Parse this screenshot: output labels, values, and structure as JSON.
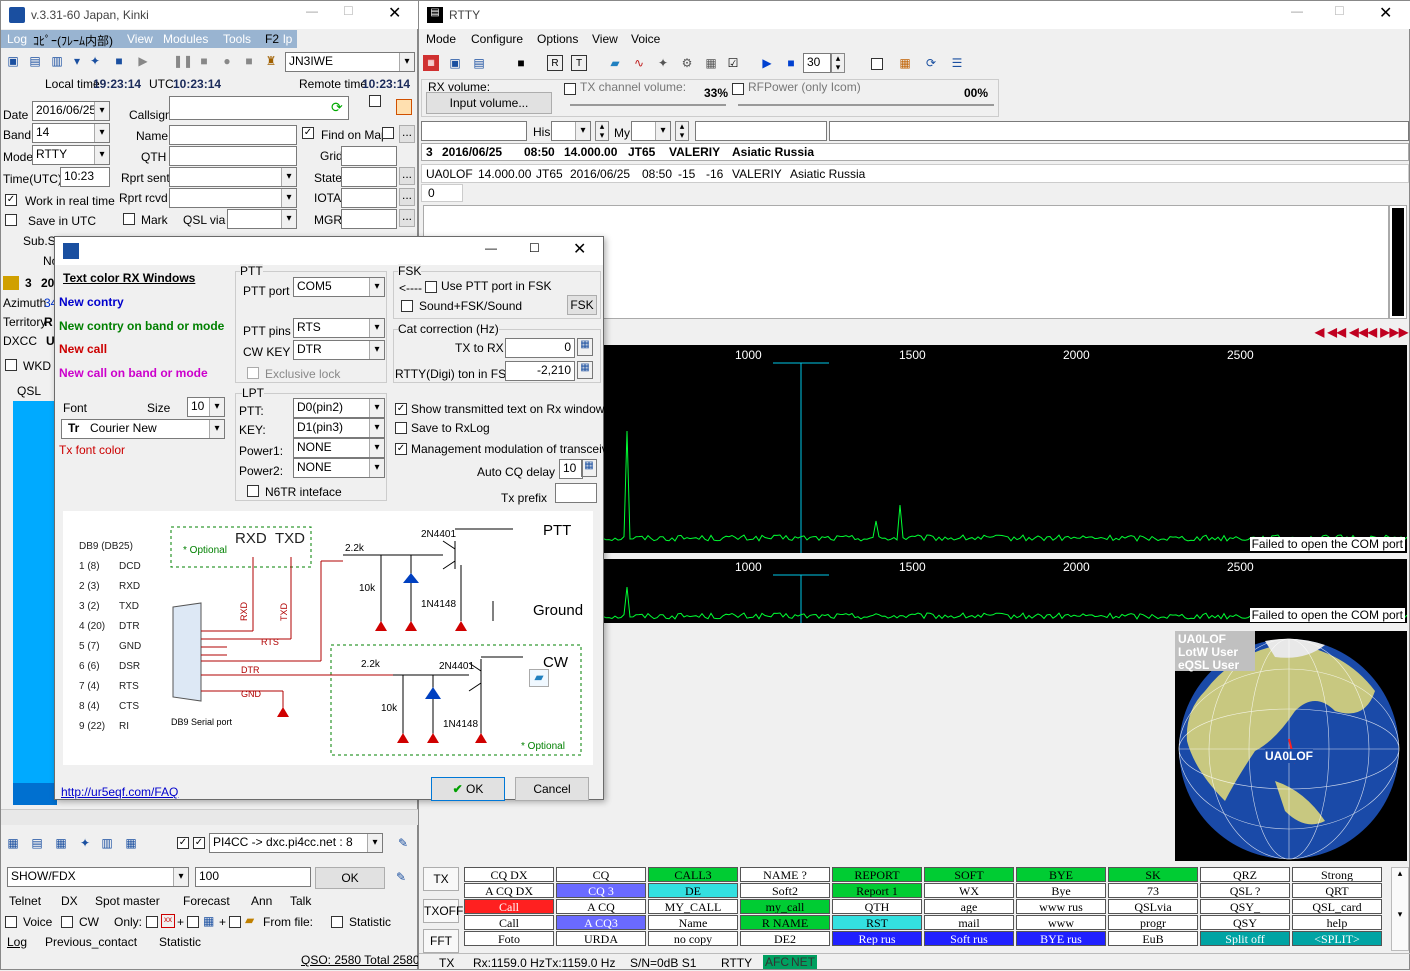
{
  "left": {
    "title": "v.3.31-60 Japan, Kinki",
    "menu": [
      "Log",
      "ｺﾋﾟｰ(ﾌﾚｰﾑ内部)",
      "View",
      "Modules",
      "Tools",
      "F2",
      "lp"
    ],
    "callsign_combo": "JN3IWE",
    "local_time_label": "Local time",
    "local_time": "19:23:14",
    "utc_label": "UTC",
    "utc_time": "10:23:14",
    "remote_label": "Remote time",
    "remote_time": "10:23:14",
    "fields": {
      "date_label": "Date",
      "date": "2016/06/25",
      "band_label": "Band",
      "band": "14",
      "mode_label": "Mode",
      "mode": "RTTY",
      "time_label": "Time(UTC)",
      "time": "10:23",
      "callsign_label": "Callsign",
      "name_label": "Name",
      "qth_label": "QTH",
      "rprt_sent_label": "Rprt sent",
      "rprt_rcvd_label": "Rprt rcvd",
      "qsl_via_label": "QSL via",
      "find_map_label": "Find on Map",
      "grid_label": "Grid",
      "state_label": "State",
      "iota_label": "IOTA",
      "mgr_label": "MGR",
      "work_real_label": "Work in real time",
      "save_utc_label": "Save in UTC",
      "mark_label": "Mark",
      "substate_label": "Sub.St",
      "no_label": "No"
    },
    "info": {
      "count": "3",
      "count2": "20",
      "azimuth_label": "Azimuth",
      "azimuth": "34",
      "territory_label": "Territory",
      "territory": "R",
      "dxcc_label": "DXCC",
      "dxcc": "U",
      "wkd_label": "WKD",
      "qsl_label": "QSL"
    },
    "cluster": {
      "server": "PI4CC -> dxc.pi4cc.net : 8",
      "show_cmd": "SHOW/FDX",
      "count": "100",
      "ok": "OK"
    },
    "tabs1": [
      "Telnet",
      "DX",
      "Spot master",
      "Forecast",
      "Ann",
      "Talk"
    ],
    "filter": {
      "voice": "Voice",
      "cw": "CW",
      "only": "Only:",
      "from_file": "From file:",
      "statistic": "Statistic"
    },
    "tabs2": [
      "Log",
      "Previous_contact",
      "Statistic"
    ],
    "status": "QSO: 2580 Total 2580"
  },
  "dialog": {
    "text_color_title": "Text color RX Windows",
    "colors": [
      {
        "t": "New contry",
        "c": "#0000cc"
      },
      {
        "t": "New contry on band or mode",
        "c": "#008000"
      },
      {
        "t": "New call",
        "c": "#cc0000"
      },
      {
        "t": "New call on band or mode",
        "c": "#cc00cc"
      }
    ],
    "font_label": "Font",
    "size_label": "Size",
    "size": "10",
    "font": "Courier New",
    "tx_font": "Tx font color",
    "ptt_group": "PTT",
    "ptt_port_label": "PTT port",
    "ptt_port": "COM5",
    "ptt_pins_label": "PTT pins",
    "ptt_pins": "RTS",
    "cw_key_label": "CW KEY",
    "cw_key": "DTR",
    "exclusive": "Exclusive lock",
    "lpt_group": "LPT",
    "lpt_ptt_label": "PTT:",
    "lpt_ptt": "D0(pin2)",
    "lpt_key_label": "KEY:",
    "lpt_key": "D1(pin3)",
    "power1_label": "Power1:",
    "power1": "NONE",
    "power2_label": "Power2:",
    "power2": "NONE",
    "n6tr": "N6TR inteface",
    "fsk_group": "FSK",
    "use_ptt_fsk": "Use PTT port in FSK",
    "sound_fsk": "Sound+FSK/Sound",
    "fsk_btn": "FSK",
    "arrow": "<----",
    "cat_group": "Cat correction (Hz)",
    "tx_to_rx_label": "TX to RX",
    "tx_to_rx": "0",
    "rtty_fsk_label": "RTTY(Digi) ton in FSK",
    "rtty_fsk": "-2,210",
    "show_tx": "Show transmitted text on Rx window",
    "save_rxlog": "Save to RxLog",
    "mgmt_mod": "Management modulation  of transceiver",
    "autocq_label": "Auto CQ delay",
    "autocq": "10",
    "txprefix_label": "Tx prefix",
    "link": "http://ur5eqf.com/FAQ",
    "ok": "OK",
    "cancel": "Cancel",
    "diagram": {
      "db9": "DB9 (DB25)",
      "pins": [
        [
          "1 (8)",
          "DCD"
        ],
        [
          "2 (3)",
          "RXD"
        ],
        [
          "3 (2)",
          "TXD"
        ],
        [
          "4 (20)",
          "DTR"
        ],
        [
          "5 (7)",
          "GND"
        ],
        [
          "6 (6)",
          "DSR"
        ],
        [
          "7 (4)",
          "RTS"
        ],
        [
          "8 (4)",
          "CTS"
        ],
        [
          "9 (22)",
          "RI"
        ]
      ],
      "optional": "* Optional",
      "rxd": "RXD",
      "txd": "TXD",
      "r1": "2.2k",
      "r2": "10k",
      "tr": "2N4401",
      "diode": "1N4148",
      "ptt": "PTT",
      "ground": "Ground",
      "cw": "CW",
      "serial": "DB9 Serial port",
      "rxd_s": "RXD",
      "txd_s": "TXD",
      "rts_s": "RTS",
      "dtr_s": "DTR",
      "gnd_s": "GND"
    }
  },
  "rtty": {
    "title": "RTTY",
    "menu": [
      "Mode",
      "Configure",
      "Options",
      "View",
      "Voice"
    ],
    "spin": "30",
    "rx_volume": "RX volume:",
    "input_volume": "Input volume...",
    "tx_volume": "TX channel volume:",
    "tx_pct": "33%",
    "rfpower": "RFPower (only Icom)",
    "rf_pct": "00%",
    "his": "His",
    "my": "My",
    "info_line": [
      "3",
      "2016/06/25",
      "08:50",
      "14.000.00",
      "JT65",
      "VALERIY",
      "Asiatic Russia"
    ],
    "list_line": [
      "UA0LOF",
      "14.000.00",
      "JT65",
      "2016/06/25",
      "08:50",
      "-15",
      "-16",
      "VALERIY",
      "Asiatic Russia"
    ],
    "zero": "0",
    "freq_ticks": [
      "1000",
      "1500",
      "2000",
      "2500"
    ],
    "fail1": "Failed to open the COM port",
    "fail2": "Failed to open the COM port",
    "globe": {
      "call": "UA0LOF",
      "lotw": "LotW User",
      "eqsl": "eQSL User",
      "marker": "UA0LOF"
    },
    "side_btns": [
      "TX",
      "TXOFF",
      "FFT"
    ],
    "macros": [
      [
        [
          "CQ DX",
          "gw"
        ],
        [
          "CQ",
          "gw"
        ],
        [
          "CALL3",
          "gg"
        ],
        [
          "NAME ?",
          "gw"
        ],
        [
          "REPORT",
          "gg"
        ],
        [
          "SOFT",
          "gg"
        ],
        [
          "BYE",
          "gg"
        ],
        [
          "SK",
          "gg"
        ],
        [
          "QRZ",
          "gw"
        ],
        [
          "Strong",
          "gw"
        ]
      ],
      [
        [
          "A CQ DX",
          "gw"
        ],
        [
          "CQ 3",
          "gb"
        ],
        [
          "DE",
          "gc"
        ],
        [
          "Soft2",
          "gw"
        ],
        [
          "Report 1",
          "gg"
        ],
        [
          "WX",
          "gw"
        ],
        [
          "Bye",
          "gw"
        ],
        [
          "73",
          "gw"
        ],
        [
          "QSL ?",
          "gw"
        ],
        [
          "QRT",
          "gw"
        ]
      ],
      [
        [
          "Call",
          "gr"
        ],
        [
          "A CQ",
          "gw"
        ],
        [
          "MY_CALL",
          "gw"
        ],
        [
          "my_call",
          "gg"
        ],
        [
          "QTH",
          "gw"
        ],
        [
          "age",
          "gw"
        ],
        [
          "www rus",
          "gw"
        ],
        [
          "QSLvia",
          "gw"
        ],
        [
          "QSY_",
          "gw"
        ],
        [
          "QSL_card",
          "gw"
        ]
      ],
      [
        [
          "Call",
          "gw"
        ],
        [
          "A CQ3",
          "gb"
        ],
        [
          "Name",
          "gw"
        ],
        [
          "R NAME",
          "gg"
        ],
        [
          "RST",
          "gc"
        ],
        [
          "mail",
          "gw"
        ],
        [
          "www",
          "gw"
        ],
        [
          "progr",
          "gw"
        ],
        [
          "QSY",
          "gw"
        ],
        [
          "help",
          "gw"
        ]
      ],
      [
        [
          "Foto",
          "gw"
        ],
        [
          "URDA",
          "gw"
        ],
        [
          "no copy",
          "gw"
        ],
        [
          "DE2",
          "gw"
        ],
        [
          "Rep rus",
          "gdb"
        ],
        [
          "Soft rus",
          "gdb"
        ],
        [
          "BYE rus",
          "gdb"
        ],
        [
          "EuB",
          "gw"
        ],
        [
          "Split off",
          "gt"
        ],
        [
          "<SPLIT>",
          "gt"
        ]
      ]
    ],
    "status": {
      "tx": "TX",
      "rx": "Rx:1159.0 Hz",
      "txf": "Tx:1159.0 Hz",
      "sn": "S/N=0dB S1",
      "mode": "RTTY",
      "afc": "AFC",
      "net": "NET"
    }
  }
}
